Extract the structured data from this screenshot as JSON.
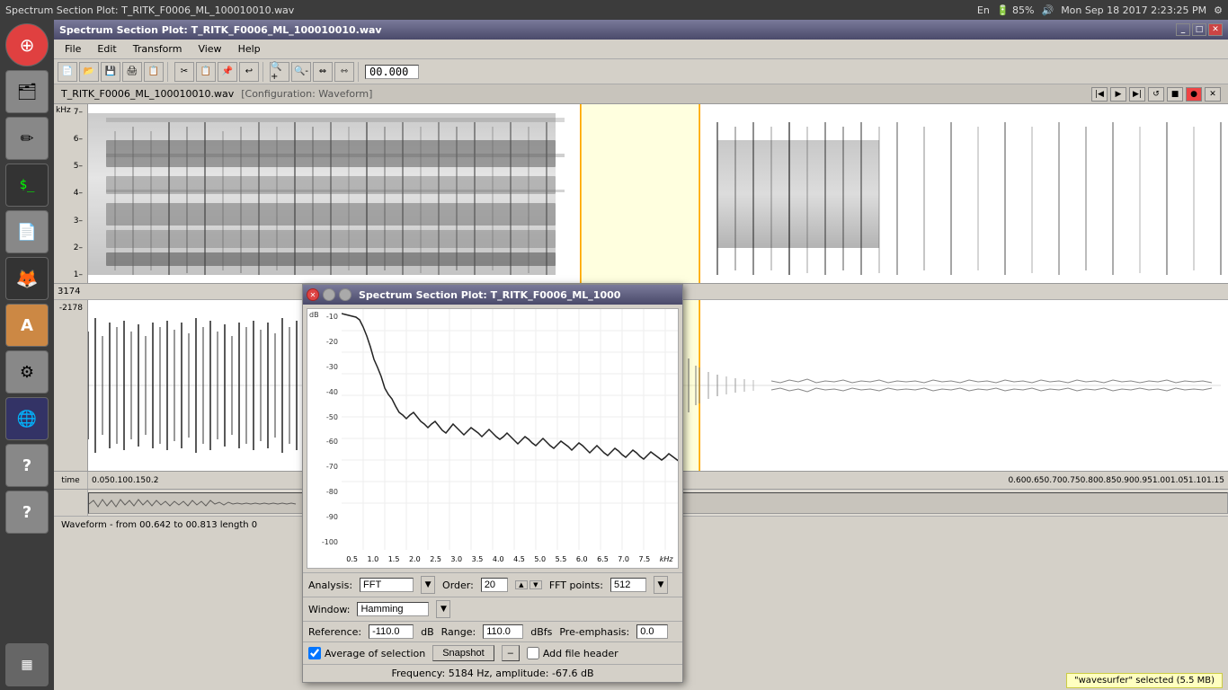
{
  "taskbar": {
    "title": "Spectrum Section Plot: T_RITK_F0006_ML_100010010.wav",
    "right": {
      "lang": "En",
      "battery": "85%",
      "datetime": "Mon Sep 18 2017  2:23:25 PM"
    }
  },
  "sidebar": {
    "icons": [
      "ubuntu",
      "files",
      "notes",
      "terminal",
      "document",
      "firefox",
      "fonts",
      "settings",
      "internet",
      "help1",
      "help2",
      "manager"
    ]
  },
  "window": {
    "title": "Spectrum Section Plot: T_RITK_F0006_ML_100010010.wav",
    "filename": "T_RITK_F0006_ML_100010010.wav",
    "config": "[Configuration: Waveform]",
    "time": "00.000"
  },
  "menu": {
    "items": [
      "File",
      "Edit",
      "Transform",
      "View",
      "Help"
    ]
  },
  "spectrum_popup": {
    "title": "Spectrum Section Plot: T_RITK_F0006_ML_1000",
    "analysis_label": "Analysis:",
    "analysis_value": "FFT",
    "order_label": "Order:",
    "order_value": "20",
    "window_label": "Window:",
    "window_value": "Hamming",
    "fft_label": "FFT points:",
    "fft_value": "512",
    "reference_label": "Reference:",
    "reference_value": "-110.0",
    "reference_unit": "dB",
    "range_label": "Range:",
    "range_value": "110.0",
    "range_unit": "dBfs",
    "preemphasis_label": "Pre-emphasis:",
    "preemphasis_value": "0.0",
    "avg_label": "Average of selection",
    "snapshot_label": "Snapshot",
    "add_header_label": "Add file header",
    "freq_status": "Frequency: 5184 Hz, amplitude: -67.6 dB",
    "y_labels": [
      "dB",
      "-10",
      "-20",
      "-30",
      "-40",
      "-50",
      "-60",
      "-70",
      "-80",
      "-90",
      "-100"
    ],
    "x_labels": [
      "0.5",
      "1.0",
      "1.5",
      "2.0",
      "2.5",
      "3.0",
      "3.5",
      "4.0",
      "4.5",
      "5.0",
      "5.5",
      "6.0",
      "6.5",
      "7.0",
      "7.5"
    ],
    "x_unit": "kHz"
  },
  "spectrogram": {
    "freq_labels": [
      "kHz",
      "7–",
      "6–",
      "5–",
      "4–",
      "3–",
      "2–",
      "1–"
    ],
    "status_left": "3174",
    "status_bottom_left": "-2178"
  },
  "time_axis": {
    "labels": [
      "0.05",
      "0.10",
      "0.15",
      "0.2",
      "0.60",
      "0.65",
      "0.70",
      "0.75",
      "0.80",
      "0.85",
      "0.90",
      "0.95",
      "1.00",
      "1.05",
      "1.10",
      "1.15"
    ]
  },
  "waveform_status": "Waveform - from 00.642 to 00.813 length 0",
  "bottom_notification": "\"wavesurfer\" selected  (5.5 MB)"
}
